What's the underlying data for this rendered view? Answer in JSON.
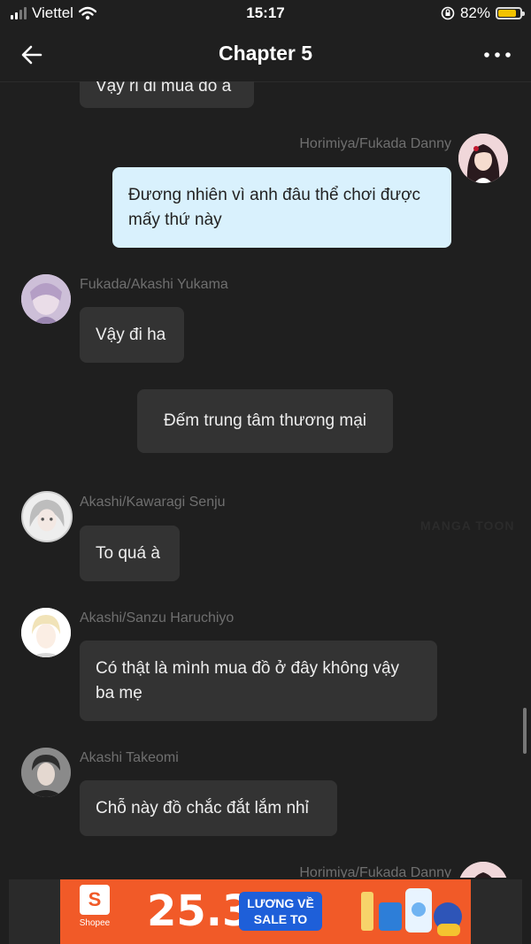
{
  "status": {
    "carrier": "Viettel",
    "time": "15:17",
    "battery": "82%",
    "battery_level": 0.82
  },
  "header": {
    "title": "Chapter 5"
  },
  "messages": [
    {
      "text": "Vậy ri đi mua đồ à"
    },
    {
      "name": "Horimiya/Fukada Danny",
      "text": "Đương nhiên vì anh đâu thể chơi được mấy thứ này"
    },
    {
      "name": "Fukada/Akashi Yukama",
      "text": "Vậy đi ha"
    },
    {
      "text": "Đếm trung tâm thương mại"
    },
    {
      "name": "Akashi/Kawaragi Senju",
      "text": "To quá à"
    },
    {
      "name": "Akashi/Sanzu Haruchiyo",
      "text": "Có thật là mình mua đồ ở đây không vậy ba mẹ"
    },
    {
      "name": "Akashi Takeomi",
      "text": "Chỗ này đồ chắc đắt lắm nhỉ"
    },
    {
      "name": "Horimiya/Fukada Danny"
    }
  ],
  "watermark": "MANGA TOON",
  "ad": {
    "brand": "Shopee",
    "bag_letter": "S",
    "date": "25.3",
    "promo_line1": "LƯƠNG VỀ",
    "promo_line2": "SALE TO"
  },
  "colors": {
    "background": "#1f1f1f",
    "bubble": "#333333",
    "my_bubble": "#d9f1fd",
    "name_text": "#6f6f6f",
    "ad_orange": "#f15a28"
  }
}
